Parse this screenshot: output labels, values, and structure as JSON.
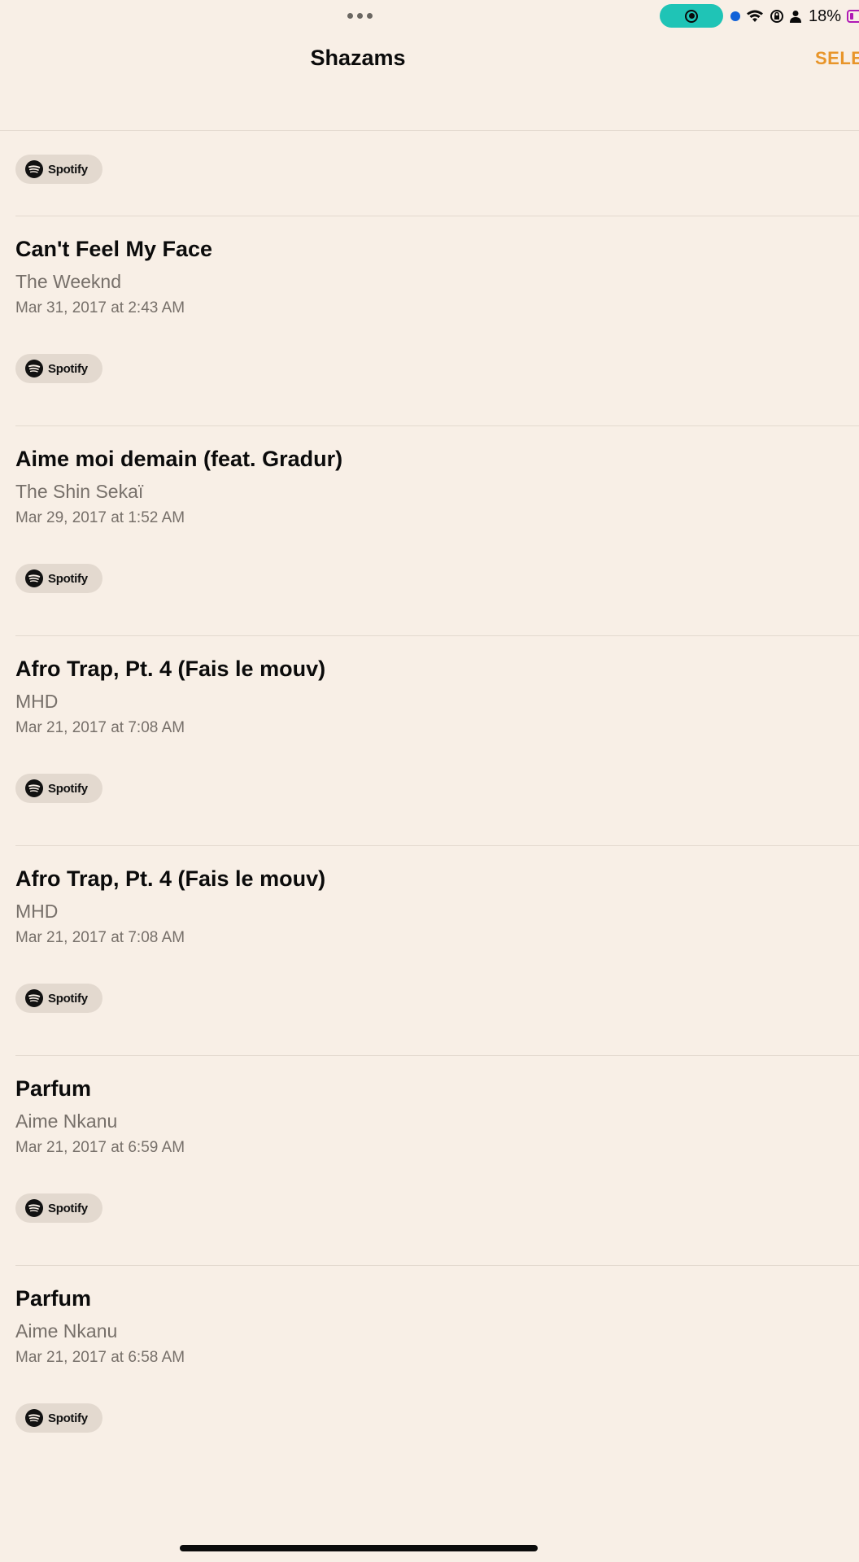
{
  "status_bar": {
    "battery_percent": "18%",
    "icons": [
      "multitask-dots-icon",
      "screen-record-icon",
      "location-dot-icon",
      "wifi-icon",
      "rotation-lock-icon",
      "person-icon",
      "battery-icon"
    ],
    "record_pill_color": "#1fc4b6",
    "battery_color": "#b01ab5"
  },
  "nav": {
    "title": "Shazams",
    "select_label": "SELECT",
    "accent_color": "#e8952a"
  },
  "chip_label": "Spotify",
  "items": [
    {
      "title": "Can't Feel My Face",
      "artist": "The Weeknd",
      "date": "Mar 31, 2017 at 2:43 AM"
    },
    {
      "title": "Aime moi demain (feat. Gradur)",
      "artist": "The Shin Sekaï",
      "date": "Mar 29, 2017 at 1:52 AM"
    },
    {
      "title": "Afro Trap, Pt. 4 (Fais le mouv)",
      "artist": "MHD",
      "date": "Mar 21, 2017 at 7:08 AM"
    },
    {
      "title": "Afro Trap, Pt. 4 (Fais le mouv)",
      "artist": "MHD",
      "date": "Mar 21, 2017 at 7:08 AM"
    },
    {
      "title": "Parfum",
      "artist": "Aime Nkanu",
      "date": "Mar 21, 2017 at 6:59 AM"
    },
    {
      "title": "Parfum",
      "artist": "Aime Nkanu",
      "date": "Mar 21, 2017 at 6:58 AM"
    }
  ]
}
